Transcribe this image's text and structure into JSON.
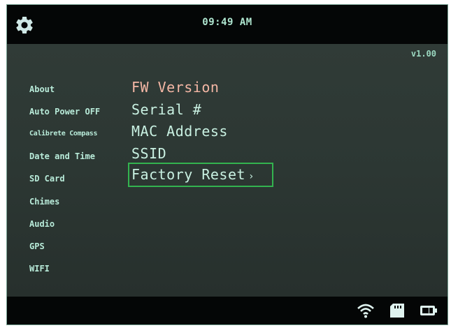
{
  "header": {
    "time": "09:49 AM",
    "settings_icon": "gear-icon"
  },
  "version": "v1.00",
  "menu": {
    "items": [
      {
        "label": "About"
      },
      {
        "label": "Auto Power OFF"
      },
      {
        "label": "Calibrete Compass"
      },
      {
        "label": "Date and Time"
      },
      {
        "label": "SD Card"
      },
      {
        "label": "Chimes"
      },
      {
        "label": "Audio"
      },
      {
        "label": "GPS"
      },
      {
        "label": "WIFI"
      }
    ]
  },
  "submenu": {
    "items": [
      {
        "label": "FW Version"
      },
      {
        "label": "Serial #"
      },
      {
        "label": "MAC Address"
      },
      {
        "label": "SSID"
      },
      {
        "label": "Factory Reset"
      }
    ],
    "selected": "Factory Reset",
    "chevron": "›"
  },
  "status_icons": [
    "wifi-icon",
    "sd-card-icon",
    "battery-icon"
  ],
  "colors": {
    "accent_green": "#33b34f",
    "highlight_text": "#f4b7a5",
    "menu_text": "#b8ebd9"
  }
}
